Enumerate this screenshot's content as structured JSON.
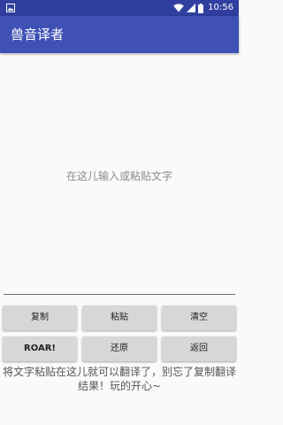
{
  "status_bar": {
    "left_icon": "image-icon",
    "right_icons": [
      "wifi-icon",
      "signal-icon",
      "battery-icon"
    ],
    "time": "10:56",
    "color": "#303f9f"
  },
  "app_bar": {
    "title": "兽音译者",
    "color": "#3f51b5"
  },
  "input": {
    "placeholder": "在这儿输入或粘贴文字",
    "value": ""
  },
  "buttons": {
    "copy": "复制",
    "paste": "粘贴",
    "clear": "清空",
    "roar": "ROAR!",
    "restore": "还原",
    "back": "返回"
  },
  "hint": "将文字粘贴在这儿就可以翻译了，别忘了复制翻译结果！玩的开心~"
}
